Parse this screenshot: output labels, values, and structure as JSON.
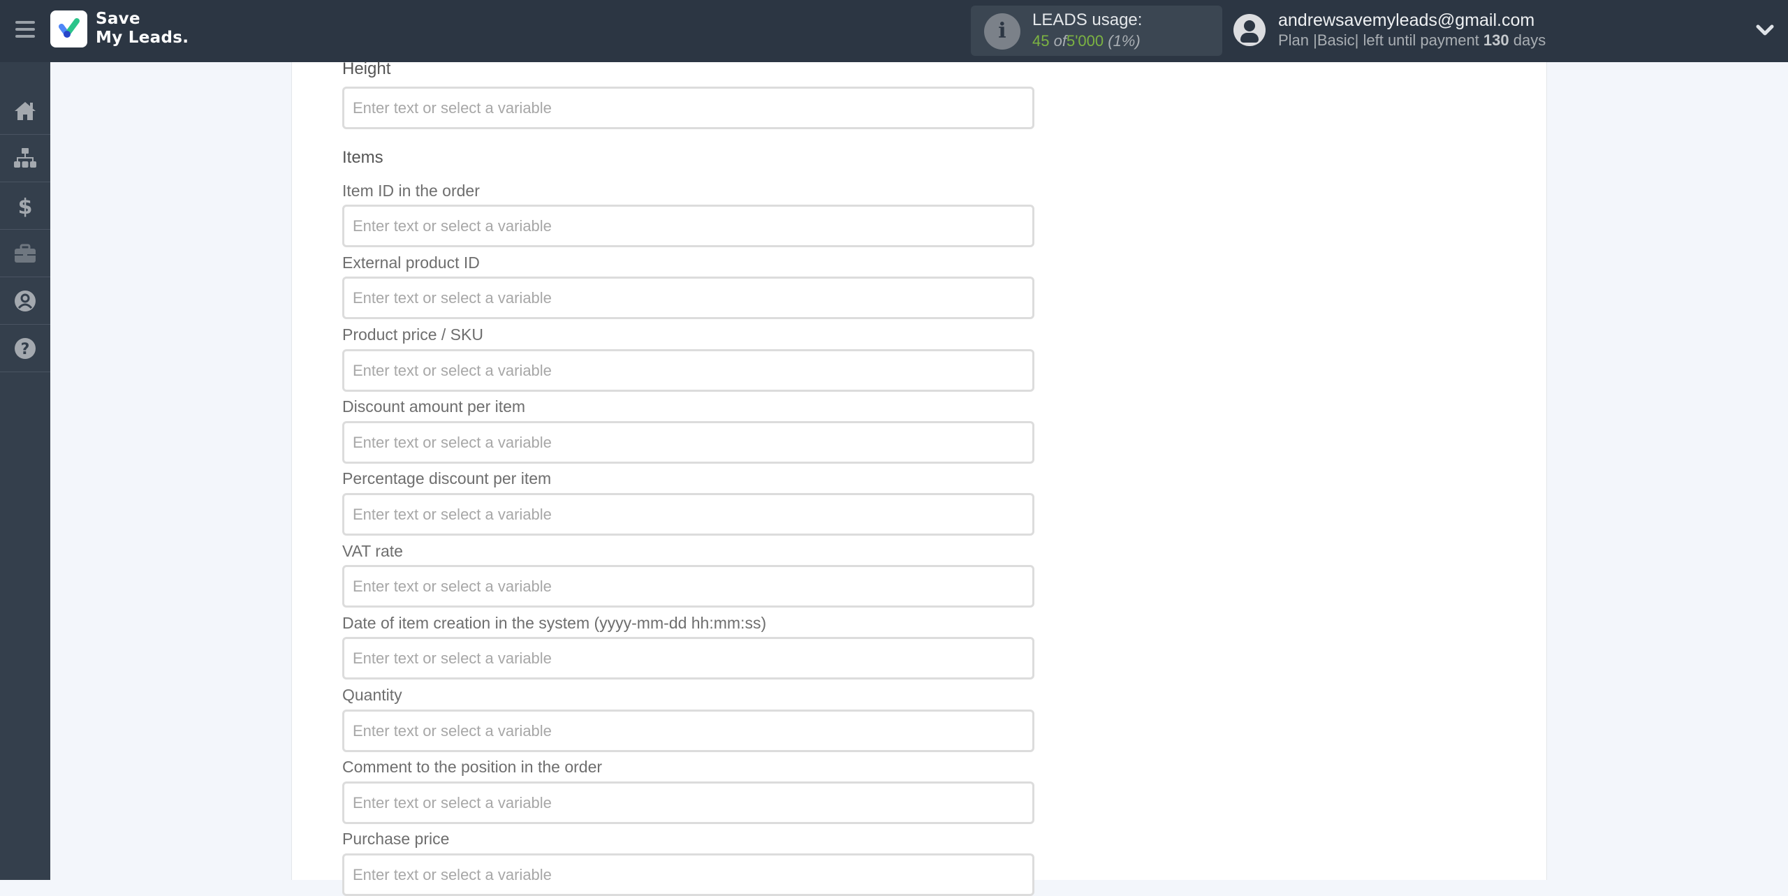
{
  "header": {
    "brand_line1": "Save",
    "brand_line2": "My Leads.",
    "usage": {
      "title": "LEADS usage:",
      "used": "45",
      "of_label": "of",
      "limit": "5'000",
      "percent": "(1%)"
    },
    "user": {
      "email": "andrewsavemyleads@gmail.com",
      "plan_prefix": "Plan |Basic| left until payment",
      "days": "130",
      "days_suffix": "days"
    }
  },
  "sidebar": {
    "items": [
      {
        "icon": "home-icon"
      },
      {
        "icon": "sitemap-icon"
      },
      {
        "icon": "dollar-icon"
      },
      {
        "icon": "briefcase-icon"
      },
      {
        "icon": "user-circle-icon"
      },
      {
        "icon": "help-icon"
      }
    ]
  },
  "form": {
    "height_label": "Height",
    "height_placeholder": "Enter text or select a variable",
    "items_section_title": "Items",
    "fields": [
      {
        "label": "Item ID in the order",
        "placeholder": "Enter text or select a variable",
        "value": ""
      },
      {
        "label": "External product ID",
        "placeholder": "Enter text or select a variable",
        "value": ""
      },
      {
        "label": "Product price / SKU",
        "placeholder": "Enter text or select a variable",
        "value": ""
      },
      {
        "label": "Discount amount per item",
        "placeholder": "Enter text or select a variable",
        "value": ""
      },
      {
        "label": "Percentage discount per item",
        "placeholder": "Enter text or select a variable",
        "value": ""
      },
      {
        "label": "VAT rate",
        "placeholder": "Enter text or select a variable",
        "value": ""
      },
      {
        "label": "Date of item creation in the system (yyyy-mm-dd hh:mm:ss)",
        "placeholder": "Enter text or select a variable",
        "value": ""
      },
      {
        "label": "Quantity",
        "placeholder": "Enter text or select a variable",
        "value": ""
      },
      {
        "label": "Comment to the position in the order",
        "placeholder": "Enter text or select a variable",
        "value": ""
      },
      {
        "label": "Purchase price",
        "placeholder": "Enter text or select a variable",
        "value": ""
      }
    ]
  },
  "colors": {
    "header_bg": "#2c3643",
    "sidebar_bg": "#343f4c",
    "usage_green": "#7cb342",
    "page_bg": "#f3f6fb"
  }
}
